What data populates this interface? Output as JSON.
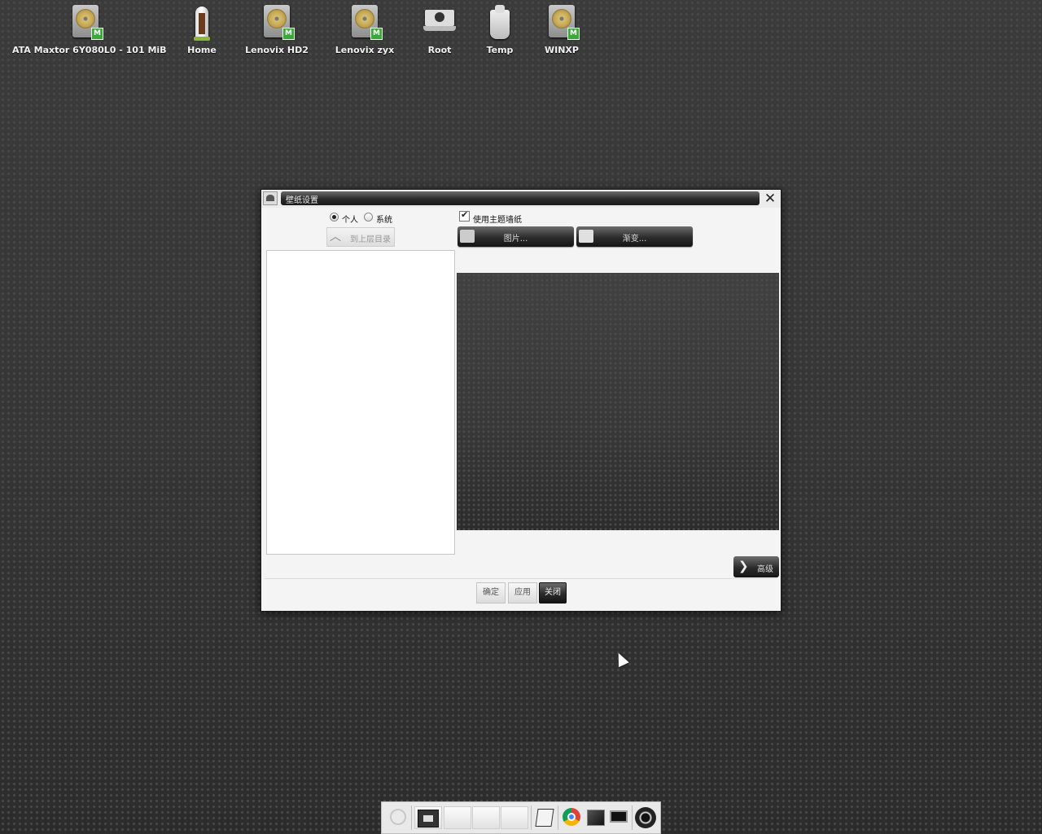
{
  "desktop": {
    "icons": [
      {
        "label": "ATA Maxtor 6Y080L0 - 101 MiB",
        "icon": "hard-drive-icon",
        "badge": "M"
      },
      {
        "label": "Home",
        "icon": "home-folder-icon"
      },
      {
        "label": "Lenovix HD2",
        "icon": "hard-drive-icon",
        "badge": "M"
      },
      {
        "label": "Lenovix zyx",
        "icon": "hard-drive-icon",
        "badge": "M"
      },
      {
        "label": "Root",
        "icon": "computer-root-icon"
      },
      {
        "label": "Temp",
        "icon": "temp-folder-icon"
      },
      {
        "label": "WINXP",
        "icon": "hard-drive-icon",
        "badge": "M"
      }
    ]
  },
  "dialog": {
    "title": "壁纸设置",
    "close_glyph": "✕",
    "source": {
      "personal_label": "个人",
      "system_label": "系统",
      "selected": "个人"
    },
    "up_button_label": "到上层目录",
    "use_theme_label": "使用主题墙纸",
    "use_theme_checked": true,
    "picture_button_label": "图片...",
    "gradient_button_label": "渐变...",
    "advanced_button_label": "高级",
    "advanced_arrow": "❯",
    "ok_label": "确定",
    "apply_label": "应用",
    "close_label": "关闭"
  },
  "taskbar": {
    "items": [
      "launcher-icon",
      "mail-icon",
      "slot",
      "slot",
      "slot",
      "files-icon",
      "chrome-icon",
      "terminal-icon",
      "monitor-icon",
      "power-icon"
    ]
  }
}
